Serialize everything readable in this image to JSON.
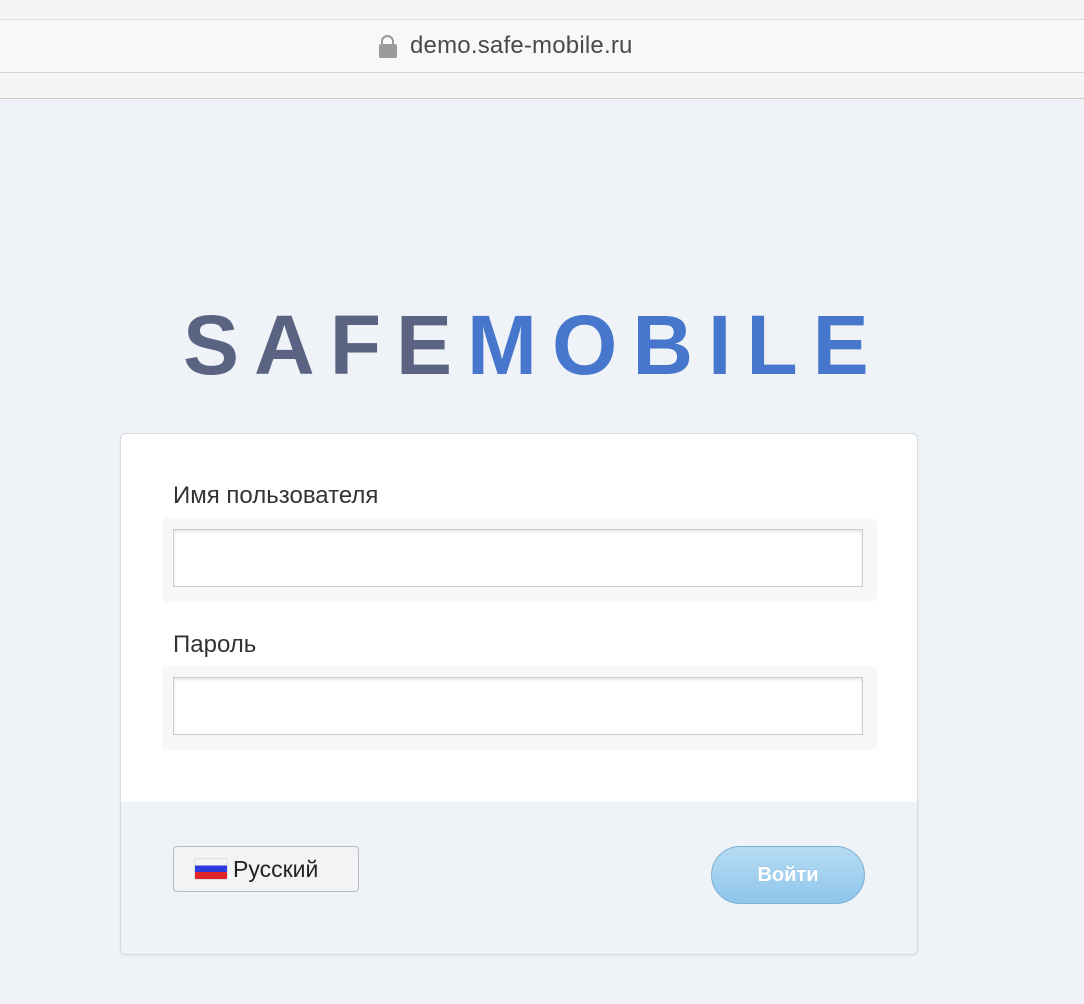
{
  "browser": {
    "url": "demo.safe-mobile.ru"
  },
  "logo": {
    "part1": "SAFE",
    "part2": "MOBILE",
    "color1": "#5a6382",
    "color2": "#4677cd"
  },
  "form": {
    "username_label": "Имя пользователя",
    "username_value": "",
    "password_label": "Пароль",
    "password_value": ""
  },
  "footer": {
    "language_label": "Русский",
    "language_icon": "russia-flag-icon",
    "login_button": "Войти"
  },
  "colors": {
    "background": "#eff2f6",
    "login_button": "#9fcfef"
  }
}
